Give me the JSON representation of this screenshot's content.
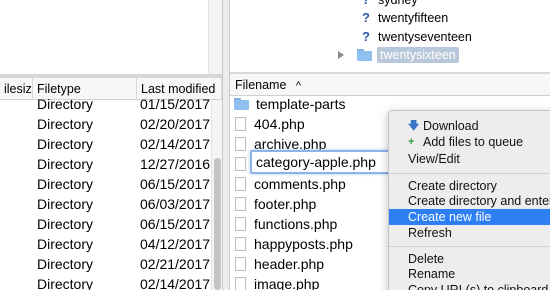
{
  "remote_tree": {
    "items": [
      {
        "label": "sydney",
        "icon": "question-icon"
      },
      {
        "label": "twentyfifteen",
        "icon": "question-icon"
      },
      {
        "label": "twentyseventeen",
        "icon": "question-icon"
      },
      {
        "label": "twentysixteen",
        "icon": "folder-icon",
        "selected": true
      }
    ]
  },
  "local_list": {
    "headers": [
      "ilesize",
      "Filetype",
      "Last modified"
    ],
    "rows": [
      {
        "filetype": "Directory",
        "modified": "01/15/2017 :"
      },
      {
        "filetype": "Directory",
        "modified": "02/20/2017"
      },
      {
        "filetype": "Directory",
        "modified": "02/14/2017"
      },
      {
        "filetype": "Directory",
        "modified": "12/27/2016"
      },
      {
        "filetype": "Directory",
        "modified": "06/15/2017"
      },
      {
        "filetype": "Directory",
        "modified": "06/03/2017"
      },
      {
        "filetype": "Directory",
        "modified": "06/15/2017"
      },
      {
        "filetype": "Directory",
        "modified": "04/12/2017"
      },
      {
        "filetype": "Directory",
        "modified": "02/21/2017"
      },
      {
        "filetype": "Directory",
        "modified": "02/14/2017"
      }
    ]
  },
  "remote_list": {
    "header": "Filename",
    "sort_indicator": "^",
    "rows": [
      {
        "name": "template-parts",
        "type": "folder"
      },
      {
        "name": "404.php",
        "type": "file"
      },
      {
        "name": "archive.php",
        "type": "file"
      },
      {
        "name": "category-apple.php",
        "type": "file",
        "editing": true
      },
      {
        "name": "comments.php",
        "type": "file"
      },
      {
        "name": "footer.php",
        "type": "file"
      },
      {
        "name": "functions.php",
        "type": "file"
      },
      {
        "name": "happyposts.php",
        "type": "file"
      },
      {
        "name": "header.php",
        "type": "file"
      },
      {
        "name": "image.php",
        "type": "file"
      }
    ]
  },
  "context_menu": {
    "items": [
      {
        "label": "Download",
        "icon": "download-icon"
      },
      {
        "label": "Add files to queue",
        "icon": "add-queue-icon"
      },
      {
        "label": "View/Edit"
      },
      {
        "separator": true
      },
      {
        "label": "Create directory"
      },
      {
        "label": "Create directory and enter"
      },
      {
        "label": "Create new file",
        "highlight": true
      },
      {
        "label": "Refresh"
      },
      {
        "separator": true
      },
      {
        "label": "Delete"
      },
      {
        "label": "Rename"
      },
      {
        "label": "Copy URL(s) to clipboard"
      }
    ]
  },
  "colors": {
    "highlight": "#2e7ef4",
    "selection": "#b9c7da",
    "folder": "#8fc0f0"
  }
}
